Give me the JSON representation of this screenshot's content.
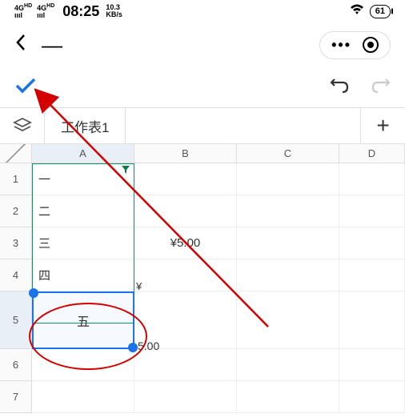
{
  "status_bar": {
    "signal1": "4G",
    "signal1_sup": "HD",
    "signal2": "4G",
    "signal2_sup": "HD",
    "time": "08:25",
    "net_speed_top": "10.3",
    "net_speed_bottom": "KB/s",
    "battery": "61"
  },
  "action_bar": {
    "confirm": "✓"
  },
  "sheet_tab": {
    "name": "工作表1"
  },
  "columns": {
    "a": "A",
    "b": "B",
    "c": "C",
    "d": "D"
  },
  "rows": {
    "r1": "1",
    "r2": "2",
    "r3": "3",
    "r4": "4",
    "r5": "5",
    "r6": "6",
    "r7": "7"
  },
  "cells": {
    "a1": "一",
    "a2": "二",
    "a3": "三",
    "a4": "四",
    "a5": "五",
    "b3": "¥5.00",
    "preview_sym": "¥",
    "preview_val": "5.00"
  },
  "chart_data": {
    "type": "table",
    "columns": [
      "A",
      "B",
      "C",
      "D"
    ],
    "rows": [
      {
        "row": 1,
        "A": "一",
        "B": "",
        "C": "",
        "D": ""
      },
      {
        "row": 2,
        "A": "二",
        "B": "",
        "C": "",
        "D": ""
      },
      {
        "row": 3,
        "A": "三",
        "B": "¥5.00",
        "C": "",
        "D": ""
      },
      {
        "row": 4,
        "A": "四",
        "B": "",
        "C": "",
        "D": ""
      },
      {
        "row": 5,
        "A": "五",
        "B": "",
        "C": "",
        "D": ""
      },
      {
        "row": 6,
        "A": "",
        "B": "",
        "C": "",
        "D": ""
      },
      {
        "row": 7,
        "A": "",
        "B": "",
        "C": "",
        "D": ""
      }
    ],
    "selected_cell": "A5",
    "filter_range": "A1:A5"
  }
}
